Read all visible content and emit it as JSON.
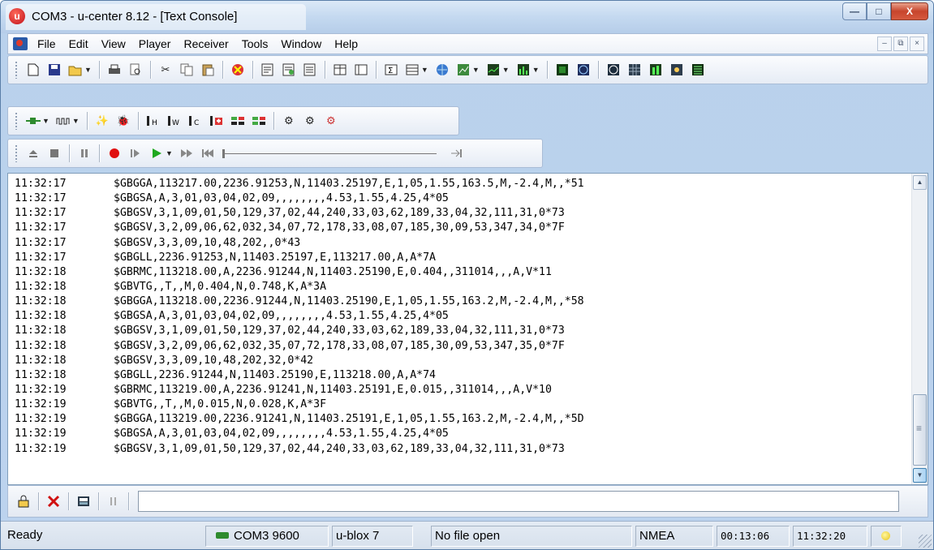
{
  "window": {
    "title": "COM3 - u-center 8.12 - [Text Console]",
    "app_icon": "u",
    "controls": {
      "minimize": "—",
      "maximize": "□",
      "close": "X"
    }
  },
  "menu": {
    "items": [
      "File",
      "Edit",
      "View",
      "Player",
      "Receiver",
      "Tools",
      "Window",
      "Help"
    ],
    "mdi_controls": [
      "–",
      "⧉",
      "×"
    ]
  },
  "toolbar1": {
    "icons": [
      "new-icon",
      "save-icon",
      "open-icon",
      "print-icon",
      "print-preview-icon",
      "cut-icon",
      "copy-icon",
      "paste-icon",
      "stop-icon",
      "doc-icon",
      "doc2-icon",
      "doc3-icon",
      "split-icon",
      "panel-icon",
      "sigma-icon",
      "table-icon",
      "globe-icon",
      "chart-icon",
      "graph-icon",
      "bar-icon",
      "monitor-icon",
      "radar-icon",
      "sky-icon",
      "grid-icon",
      "meter-icon",
      "settings-icon",
      "list-icon"
    ]
  },
  "toolbar2": {
    "icons": [
      "connect-icon",
      "baud-icon",
      "wizard-icon",
      "debug-icon",
      "hex-icon",
      "wave-icon",
      "config-icon",
      "poll-icon",
      "msg-icon",
      "msg2-icon",
      "gear1-icon",
      "gear2-icon",
      "gear3-icon"
    ]
  },
  "toolbar3": {
    "icons": [
      "eject-icon",
      "stop-square-icon",
      "pause-icon",
      "record-icon",
      "step-icon",
      "play-icon",
      "fast-forward-icon",
      "rewind-icon",
      "slider-icon",
      "end-icon"
    ]
  },
  "console": {
    "lines": [
      {
        "time": "11:32:17",
        "msg": "$GBGGA,113217.00,2236.91253,N,11403.25197,E,1,05,1.55,163.5,M,-2.4,M,,*51"
      },
      {
        "time": "11:32:17",
        "msg": "$GBGSA,A,3,01,03,04,02,09,,,,,,,,4.53,1.55,4.25,4*05"
      },
      {
        "time": "11:32:17",
        "msg": "$GBGSV,3,1,09,01,50,129,37,02,44,240,33,03,62,189,33,04,32,111,31,0*73"
      },
      {
        "time": "11:32:17",
        "msg": "$GBGSV,3,2,09,06,62,032,34,07,72,178,33,08,07,185,30,09,53,347,34,0*7F"
      },
      {
        "time": "11:32:17",
        "msg": "$GBGSV,3,3,09,10,48,202,,0*43"
      },
      {
        "time": "11:32:17",
        "msg": "$GBGLL,2236.91253,N,11403.25197,E,113217.00,A,A*7A"
      },
      {
        "time": "11:32:18",
        "msg": "$GBRMC,113218.00,A,2236.91244,N,11403.25190,E,0.404,,311014,,,A,V*11"
      },
      {
        "time": "11:32:18",
        "msg": "$GBVTG,,T,,M,0.404,N,0.748,K,A*3A"
      },
      {
        "time": "11:32:18",
        "msg": "$GBGGA,113218.00,2236.91244,N,11403.25190,E,1,05,1.55,163.2,M,-2.4,M,,*58"
      },
      {
        "time": "11:32:18",
        "msg": "$GBGSA,A,3,01,03,04,02,09,,,,,,,,4.53,1.55,4.25,4*05"
      },
      {
        "time": "11:32:18",
        "msg": "$GBGSV,3,1,09,01,50,129,37,02,44,240,33,03,62,189,33,04,32,111,31,0*73"
      },
      {
        "time": "11:32:18",
        "msg": "$GBGSV,3,2,09,06,62,032,35,07,72,178,33,08,07,185,30,09,53,347,35,0*7F"
      },
      {
        "time": "11:32:18",
        "msg": "$GBGSV,3,3,09,10,48,202,32,0*42"
      },
      {
        "time": "11:32:18",
        "msg": "$GBGLL,2236.91244,N,11403.25190,E,113218.00,A,A*74"
      },
      {
        "time": "11:32:19",
        "msg": "$GBRMC,113219.00,A,2236.91241,N,11403.25191,E,0.015,,311014,,,A,V*10"
      },
      {
        "time": "11:32:19",
        "msg": "$GBVTG,,T,,M,0.015,N,0.028,K,A*3F"
      },
      {
        "time": "11:32:19",
        "msg": "$GBGGA,113219.00,2236.91241,N,11403.25191,E,1,05,1.55,163.2,M,-2.4,M,,*5D"
      },
      {
        "time": "11:32:19",
        "msg": "$GBGSA,A,3,01,03,04,02,09,,,,,,,,4.53,1.55,4.25,4*05"
      },
      {
        "time": "11:32:19",
        "msg": "$GBGSV,3,1,09,01,50,129,37,02,44,240,33,03,62,189,33,04,32,111,31,0*73"
      }
    ]
  },
  "command_input": {
    "value": ""
  },
  "statusbar": {
    "status": "Ready",
    "port": "COM3 9600",
    "receiver": "u-blox 7",
    "file": "No file open",
    "protocol": "NMEA",
    "elapsed": "00:13:06",
    "clock": "11:32:20"
  }
}
